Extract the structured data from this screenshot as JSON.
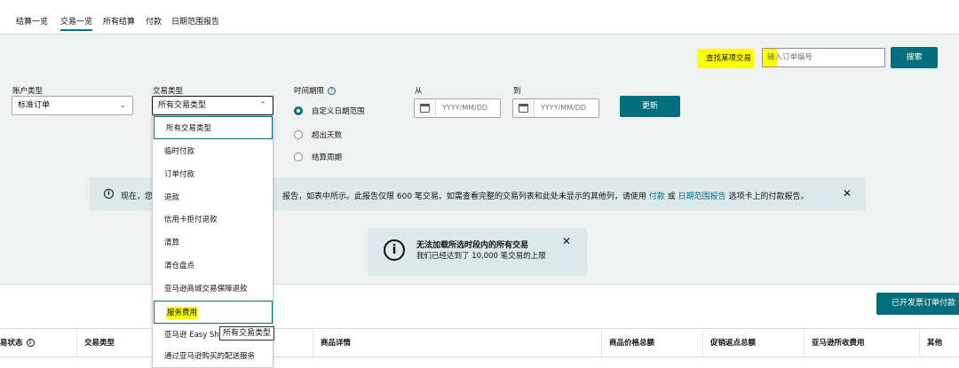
{
  "tabs": [
    "结算一览",
    "交易一览",
    "所有结算",
    "付款",
    "日期范围报告"
  ],
  "search": {
    "label": "查找某项交易",
    "placeholder": "输入订单编号",
    "button": "搜索"
  },
  "filters": {
    "account_type_label": "账户类型",
    "account_type_value": "标准订单",
    "transaction_type_label": "交易类型",
    "transaction_type_value": "所有交易类型",
    "period_label": "时间期限",
    "radios": [
      "自定义日期范围",
      "超出天数",
      "结算周期"
    ],
    "from_label": "从",
    "to_label": "到",
    "date_placeholder": "YYYY/MM/DD",
    "update_button": "更新"
  },
  "dropdown_options": [
    "所有交易类型",
    "临时付款",
    "订单付款",
    "退款",
    "信用卡拒付退款",
    "清算",
    "清仓盘点",
    "亚马逊商城交易保障退款",
    "服务费用",
    "亚马逊 Easy Sh",
    "通过亚马逊购买的配送服务"
  ],
  "tooltip": "所有交易类型",
  "banner": {
    "prefix": "现在，您",
    "text_a": "报告，如表中所示。此报告仅限 600 笔交易。如需查看完整的交易列表和此处未显示的其他列，请使用",
    "link1": "付款",
    "text_b": "或",
    "link2": "日期范围报告",
    "text_c": "选项卡上的付款报告。"
  },
  "limit_notice": {
    "title": "无法加载所选时段内的所有交易",
    "sub": "我们已经达到了 10,000 笔交易的上限"
  },
  "export_button": "已开发票订单付款",
  "table_headers": [
    "易状态",
    "交易类型",
    "商品详情",
    "商品价格总额",
    "促销返点总额",
    "亚马逊所收费用",
    "其他"
  ],
  "colors": {
    "accent": "#007185",
    "button": "#006e7d",
    "highlight": "#ffff00",
    "banner_bg": "#dde8ea"
  }
}
